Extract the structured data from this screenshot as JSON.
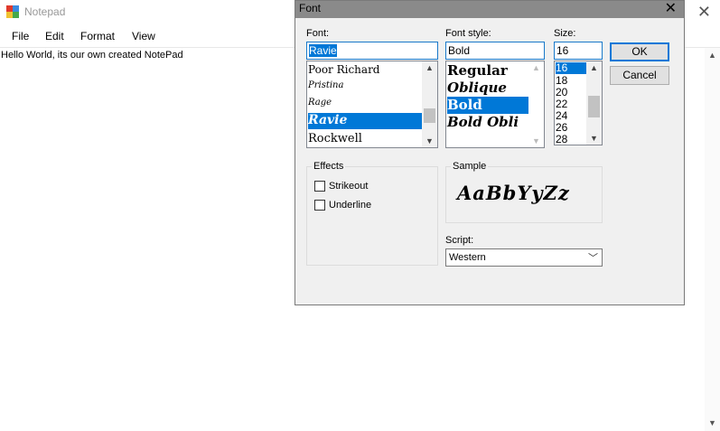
{
  "notepad": {
    "title": "Notepad",
    "menu": [
      "File",
      "Edit",
      "Format",
      "View"
    ],
    "content": "Hello World, its our own created NotePad"
  },
  "font_dialog": {
    "title": "Font",
    "font_label": "Font:",
    "font_value": "Ravie",
    "font_list": [
      "Poor Richard",
      "Pristina",
      "Rage",
      "Ravie",
      "Rockwell"
    ],
    "font_selected": "Ravie",
    "style_label": "Font style:",
    "style_value": "Bold",
    "style_list": [
      "Regular",
      "Oblique",
      "Bold",
      "Bold Obli"
    ],
    "style_selected": "Bold",
    "size_label": "Size:",
    "size_value": "16",
    "size_list": [
      "16",
      "18",
      "20",
      "22",
      "24",
      "26",
      "28"
    ],
    "size_selected": "16",
    "ok_label": "OK",
    "cancel_label": "Cancel",
    "effects_label": "Effects",
    "strikeout_label": "Strikeout",
    "underline_label": "Underline",
    "strikeout_checked": false,
    "underline_checked": false,
    "sample_label": "Sample",
    "sample_text": "AaBbYyZz",
    "script_label": "Script:",
    "script_value": "Western"
  },
  "colors": {
    "selection": "#0078d7",
    "dialog_bg": "#f0f0f0",
    "dialog_titlebar": "#8a8a8a"
  }
}
